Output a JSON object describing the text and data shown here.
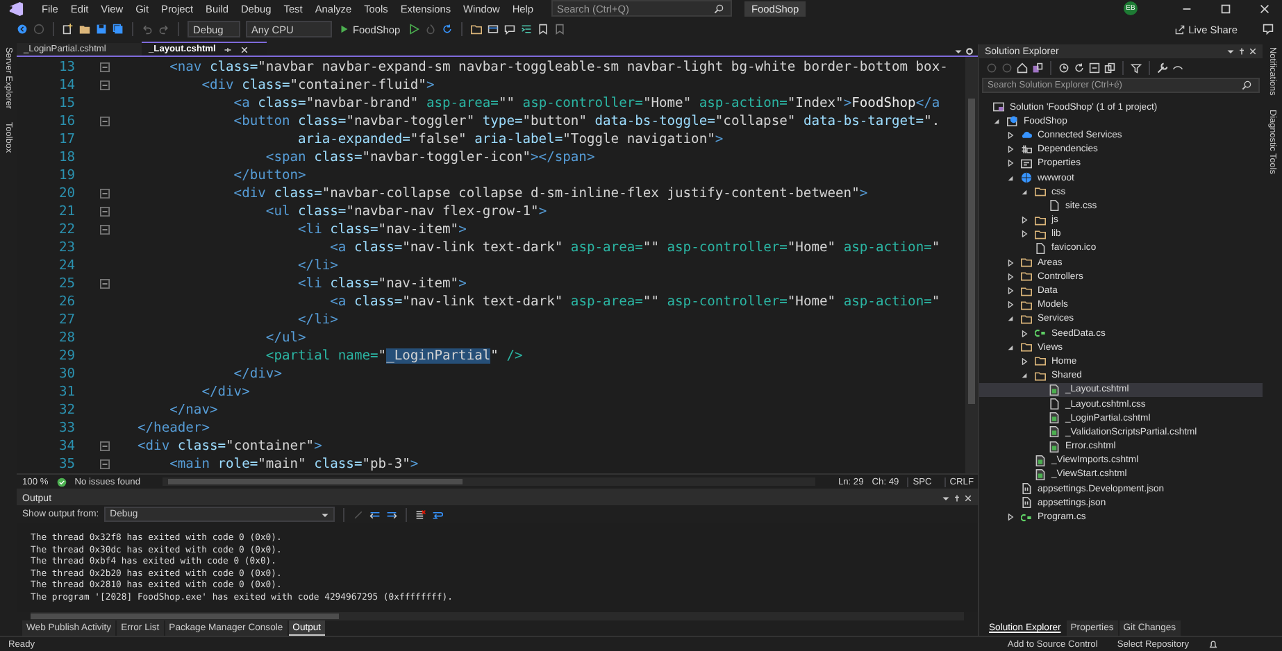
{
  "menu_bar": {
    "items": [
      "File",
      "Edit",
      "View",
      "Git",
      "Project",
      "Build",
      "Debug",
      "Test",
      "Analyze",
      "Tools",
      "Extensions",
      "Window",
      "Help"
    ],
    "search": {
      "placeholder": "Search (Ctrl+Q)"
    },
    "solution_name": "FoodShop",
    "account_initials": "EB"
  },
  "toolbar": {
    "configuration": "Debug",
    "platform": "Any CPU",
    "start_target": "FoodShop",
    "live_share": "Live Share"
  },
  "left_rail": [
    "Server Explorer",
    "Toolbox"
  ],
  "editor_tabs": [
    {
      "label": "_LoginPartial.cshtml",
      "selected": false
    },
    {
      "label": "_Layout.cshtml",
      "selected": true
    }
  ],
  "code": {
    "lines": [
      {
        "number": "13",
        "fold": true,
        "tokens": [
          {
            "kind": "tag",
            "text": "    <nav"
          },
          {
            "kind": "attr",
            "text": " class="
          },
          {
            "kind": "str",
            "text": "\"navbar navbar-expand-sm navbar-toggleable-sm navbar-light bg-white border-bottom box-"
          }
        ]
      },
      {
        "number": "14",
        "fold": true,
        "tokens": [
          {
            "kind": "tag",
            "text": "        <div"
          },
          {
            "kind": "attr",
            "text": " class="
          },
          {
            "kind": "str",
            "text": "\"container-fluid\""
          },
          {
            "kind": "tag",
            "text": ">"
          }
        ]
      },
      {
        "number": "15",
        "fold": false,
        "tokens": [
          {
            "kind": "tag",
            "text": "            <a"
          },
          {
            "kind": "attr",
            "text": " class="
          },
          {
            "kind": "str",
            "text": "\"navbar-brand\""
          },
          {
            "kind": "helper",
            "text": " asp-area="
          },
          {
            "kind": "str",
            "text": "\"\""
          },
          {
            "kind": "helper",
            "text": " asp-controller="
          },
          {
            "kind": "str",
            "text": "\"Home\""
          },
          {
            "kind": "helper",
            "text": " asp-action="
          },
          {
            "kind": "str",
            "text": "\"Index\""
          },
          {
            "kind": "tag",
            "text": ">"
          },
          {
            "kind": "text",
            "text": "FoodShop"
          },
          {
            "kind": "tag",
            "text": "</a"
          }
        ]
      },
      {
        "number": "16",
        "fold": true,
        "tokens": [
          {
            "kind": "tag",
            "text": "            <button"
          },
          {
            "kind": "attr",
            "text": " class="
          },
          {
            "kind": "str",
            "text": "\"navbar-toggler\""
          },
          {
            "kind": "attr",
            "text": " type="
          },
          {
            "kind": "str",
            "text": "\"button\""
          },
          {
            "kind": "attr",
            "text": " data-bs-toggle="
          },
          {
            "kind": "str",
            "text": "\"collapse\""
          },
          {
            "kind": "attr",
            "text": " data-bs-target="
          },
          {
            "kind": "str",
            "text": "\"."
          }
        ]
      },
      {
        "number": "17",
        "fold": false,
        "tokens": [
          {
            "kind": "attr",
            "text": "                    aria-expanded="
          },
          {
            "kind": "str",
            "text": "\"false\""
          },
          {
            "kind": "attr",
            "text": " aria-label="
          },
          {
            "kind": "str",
            "text": "\"Toggle navigation\""
          },
          {
            "kind": "tag",
            "text": ">"
          }
        ]
      },
      {
        "number": "18",
        "fold": false,
        "tokens": [
          {
            "kind": "tag",
            "text": "                <span"
          },
          {
            "kind": "attr",
            "text": " class="
          },
          {
            "kind": "str",
            "text": "\"navbar-toggler-icon\""
          },
          {
            "kind": "tag",
            "text": "></span>"
          }
        ]
      },
      {
        "number": "19",
        "fold": false,
        "tokens": [
          {
            "kind": "tag",
            "text": "            </button>"
          }
        ]
      },
      {
        "number": "20",
        "fold": true,
        "tokens": [
          {
            "kind": "tag",
            "text": "            <div"
          },
          {
            "kind": "attr",
            "text": " class="
          },
          {
            "kind": "str",
            "text": "\"navbar-collapse collapse d-sm-inline-flex justify-content-between\""
          },
          {
            "kind": "tag",
            "text": ">"
          }
        ]
      },
      {
        "number": "21",
        "fold": true,
        "tokens": [
          {
            "kind": "tag",
            "text": "                <ul"
          },
          {
            "kind": "attr",
            "text": " class="
          },
          {
            "kind": "str",
            "text": "\"navbar-nav flex-grow-1\""
          },
          {
            "kind": "tag",
            "text": ">"
          }
        ]
      },
      {
        "number": "22",
        "fold": true,
        "tokens": [
          {
            "kind": "tag",
            "text": "                    <li"
          },
          {
            "kind": "attr",
            "text": " class="
          },
          {
            "kind": "str",
            "text": "\"nav-item\""
          },
          {
            "kind": "tag",
            "text": ">"
          }
        ]
      },
      {
        "number": "23",
        "fold": false,
        "tokens": [
          {
            "kind": "tag",
            "text": "                        <a"
          },
          {
            "kind": "attr",
            "text": " class="
          },
          {
            "kind": "str",
            "text": "\"nav-link text-dark\""
          },
          {
            "kind": "helper",
            "text": " asp-area="
          },
          {
            "kind": "str",
            "text": "\"\""
          },
          {
            "kind": "helper",
            "text": " asp-controller="
          },
          {
            "kind": "str",
            "text": "\"Home\""
          },
          {
            "kind": "helper",
            "text": " asp-action="
          },
          {
            "kind": "str",
            "text": "\""
          }
        ]
      },
      {
        "number": "24",
        "fold": false,
        "tokens": [
          {
            "kind": "tag",
            "text": "                    </li>"
          }
        ]
      },
      {
        "number": "25",
        "fold": true,
        "tokens": [
          {
            "kind": "tag",
            "text": "                    <li"
          },
          {
            "kind": "attr",
            "text": " class="
          },
          {
            "kind": "str",
            "text": "\"nav-item\""
          },
          {
            "kind": "tag",
            "text": ">"
          }
        ]
      },
      {
        "number": "26",
        "fold": false,
        "tokens": [
          {
            "kind": "tag",
            "text": "                        <a"
          },
          {
            "kind": "attr",
            "text": " class="
          },
          {
            "kind": "str",
            "text": "\"nav-link text-dark\""
          },
          {
            "kind": "helper",
            "text": " asp-area="
          },
          {
            "kind": "str",
            "text": "\"\""
          },
          {
            "kind": "helper",
            "text": " asp-controller="
          },
          {
            "kind": "str",
            "text": "\"Home\""
          },
          {
            "kind": "helper",
            "text": " asp-action="
          },
          {
            "kind": "str",
            "text": "\""
          }
        ]
      },
      {
        "number": "27",
        "fold": false,
        "tokens": [
          {
            "kind": "tag",
            "text": "                    </li>"
          }
        ]
      },
      {
        "number": "28",
        "fold": false,
        "tokens": [
          {
            "kind": "tag",
            "text": "                </ul>"
          }
        ]
      },
      {
        "number": "29",
        "fold": false,
        "tokens": [
          {
            "kind": "helper",
            "text": "                <partial"
          },
          {
            "kind": "helper",
            "text": " name="
          },
          {
            "kind": "str",
            "text": "\""
          },
          {
            "kind": "str",
            "text": "_LoginPartial",
            "highlighted": true
          },
          {
            "kind": "str",
            "text": "\""
          },
          {
            "kind": "helper",
            "text": " />"
          }
        ]
      },
      {
        "number": "30",
        "fold": false,
        "tokens": [
          {
            "kind": "tag",
            "text": "            </div>"
          }
        ]
      },
      {
        "number": "31",
        "fold": false,
        "tokens": [
          {
            "kind": "tag",
            "text": "        </div>"
          }
        ]
      },
      {
        "number": "32",
        "fold": false,
        "tokens": [
          {
            "kind": "tag",
            "text": "    </nav>"
          }
        ]
      },
      {
        "number": "33",
        "fold": false,
        "tokens": [
          {
            "kind": "tag",
            "text": "</header>"
          }
        ]
      },
      {
        "number": "34",
        "fold": true,
        "tokens": [
          {
            "kind": "tag",
            "text": "<div"
          },
          {
            "kind": "attr",
            "text": " class="
          },
          {
            "kind": "str",
            "text": "\"container\""
          },
          {
            "kind": "tag",
            "text": ">"
          }
        ]
      },
      {
        "number": "35",
        "fold": true,
        "tokens": [
          {
            "kind": "tag",
            "text": "    <main"
          },
          {
            "kind": "attr",
            "text": " role="
          },
          {
            "kind": "str",
            "text": "\"main\""
          },
          {
            "kind": "attr",
            "text": " class="
          },
          {
            "kind": "str",
            "text": "\"pb-3\""
          },
          {
            "kind": "tag",
            "text": ">"
          }
        ]
      }
    ]
  },
  "editor_status": {
    "zoom": "100 %",
    "issues": "No issues found",
    "line": "Ln: 29",
    "column": "Ch: 49",
    "whitespace": "SPC",
    "line_ending": "CRLF"
  },
  "output": {
    "title": "Output",
    "source_label": "Show output from:",
    "source": "Debug",
    "lines": [
      "The thread 0x32f8 has exited with code 0 (0x0).",
      "The thread 0x30dc has exited with code 0 (0x0).",
      "The thread 0xbf4 has exited with code 0 (0x0).",
      "The thread 0x2b20 has exited with code 0 (0x0).",
      "The thread 0x2810 has exited with code 0 (0x0).",
      "The program '[2028] FoodShop.exe' has exited with code 4294967295 (0xffffffff)."
    ],
    "tabs": [
      {
        "label": "Web Publish Activity",
        "selected": false
      },
      {
        "label": "Error List",
        "selected": false
      },
      {
        "label": "Package Manager Console",
        "selected": false
      },
      {
        "label": "Output",
        "selected": true
      }
    ]
  },
  "solution_explorer": {
    "title": "Solution Explorer",
    "search": {
      "placeholder": "Search Solution Explorer (Ctrl+é)"
    },
    "tree": [
      {
        "label": "Solution 'FoodShop' (1 of 1 project)",
        "kind": "solution",
        "selected": false,
        "children": [
          {
            "label": "FoodShop",
            "kind": "project",
            "selected": false,
            "expanded": true,
            "children": [
              {
                "label": "Connected Services",
                "kind": "connected",
                "selected": false,
                "expanded": false
              },
              {
                "label": "Dependencies",
                "kind": "dependencies",
                "selected": false,
                "expanded": false
              },
              {
                "label": "Properties",
                "kind": "properties",
                "selected": false,
                "expanded": false
              },
              {
                "label": "wwwroot",
                "kind": "globe",
                "selected": false,
                "expanded": true,
                "children": [
                  {
                    "label": "css",
                    "kind": "folder",
                    "selected": false,
                    "expanded": true,
                    "children": [
                      {
                        "label": "site.css",
                        "kind": "file",
                        "selected": false
                      }
                    ]
                  },
                  {
                    "label": "js",
                    "kind": "folder",
                    "selected": false,
                    "expanded": false
                  },
                  {
                    "label": "lib",
                    "kind": "folder",
                    "selected": false,
                    "expanded": false
                  },
                  {
                    "label": "favicon.ico",
                    "kind": "file",
                    "selected": false
                  }
                ]
              },
              {
                "label": "Areas",
                "kind": "folder",
                "selected": false,
                "expanded": false
              },
              {
                "label": "Controllers",
                "kind": "folder",
                "selected": false,
                "expanded": false
              },
              {
                "label": "Data",
                "kind": "folder",
                "selected": false,
                "expanded": false
              },
              {
                "label": "Models",
                "kind": "folder",
                "selected": false,
                "expanded": false
              },
              {
                "label": "Services",
                "kind": "folder",
                "selected": false,
                "expanded": true,
                "children": [
                  {
                    "label": "SeedData.cs",
                    "kind": "csharp",
                    "selected": false,
                    "expanded": false
                  }
                ]
              },
              {
                "label": "Views",
                "kind": "folder",
                "selected": false,
                "expanded": true,
                "children": [
                  {
                    "label": "Home",
                    "kind": "folder",
                    "selected": false,
                    "expanded": false
                  },
                  {
                    "label": "Shared",
                    "kind": "folder",
                    "selected": false,
                    "expanded": true,
                    "children": [
                      {
                        "label": "_Layout.cshtml",
                        "kind": "razor",
                        "selected": true
                      },
                      {
                        "label": "_Layout.cshtml.css",
                        "kind": "file",
                        "selected": false
                      },
                      {
                        "label": "_LoginPartial.cshtml",
                        "kind": "razor",
                        "selected": false
                      },
                      {
                        "label": "_ValidationScriptsPartial.cshtml",
                        "kind": "razor",
                        "selected": false
                      },
                      {
                        "label": "Error.cshtml",
                        "kind": "razor",
                        "selected": false
                      }
                    ]
                  },
                  {
                    "label": "_ViewImports.cshtml",
                    "kind": "razor",
                    "selected": false
                  },
                  {
                    "label": "_ViewStart.cshtml",
                    "kind": "razor",
                    "selected": false
                  }
                ]
              },
              {
                "label": "appsettings.Development.json",
                "kind": "json",
                "selected": false
              },
              {
                "label": "appsettings.json",
                "kind": "json",
                "selected": false
              },
              {
                "label": "Program.cs",
                "kind": "csharp",
                "selected": false,
                "expanded": false
              }
            ]
          }
        ]
      }
    ],
    "tabs": [
      {
        "label": "Solution Explorer",
        "selected": true
      },
      {
        "label": "Properties",
        "selected": false
      },
      {
        "label": "Git Changes",
        "selected": false
      }
    ]
  },
  "right_rail": [
    "Notifications",
    "Diagnostic Tools"
  ],
  "status_bar": {
    "message": "Ready",
    "source_control": "Add to Source Control",
    "repository": "Select Repository"
  }
}
